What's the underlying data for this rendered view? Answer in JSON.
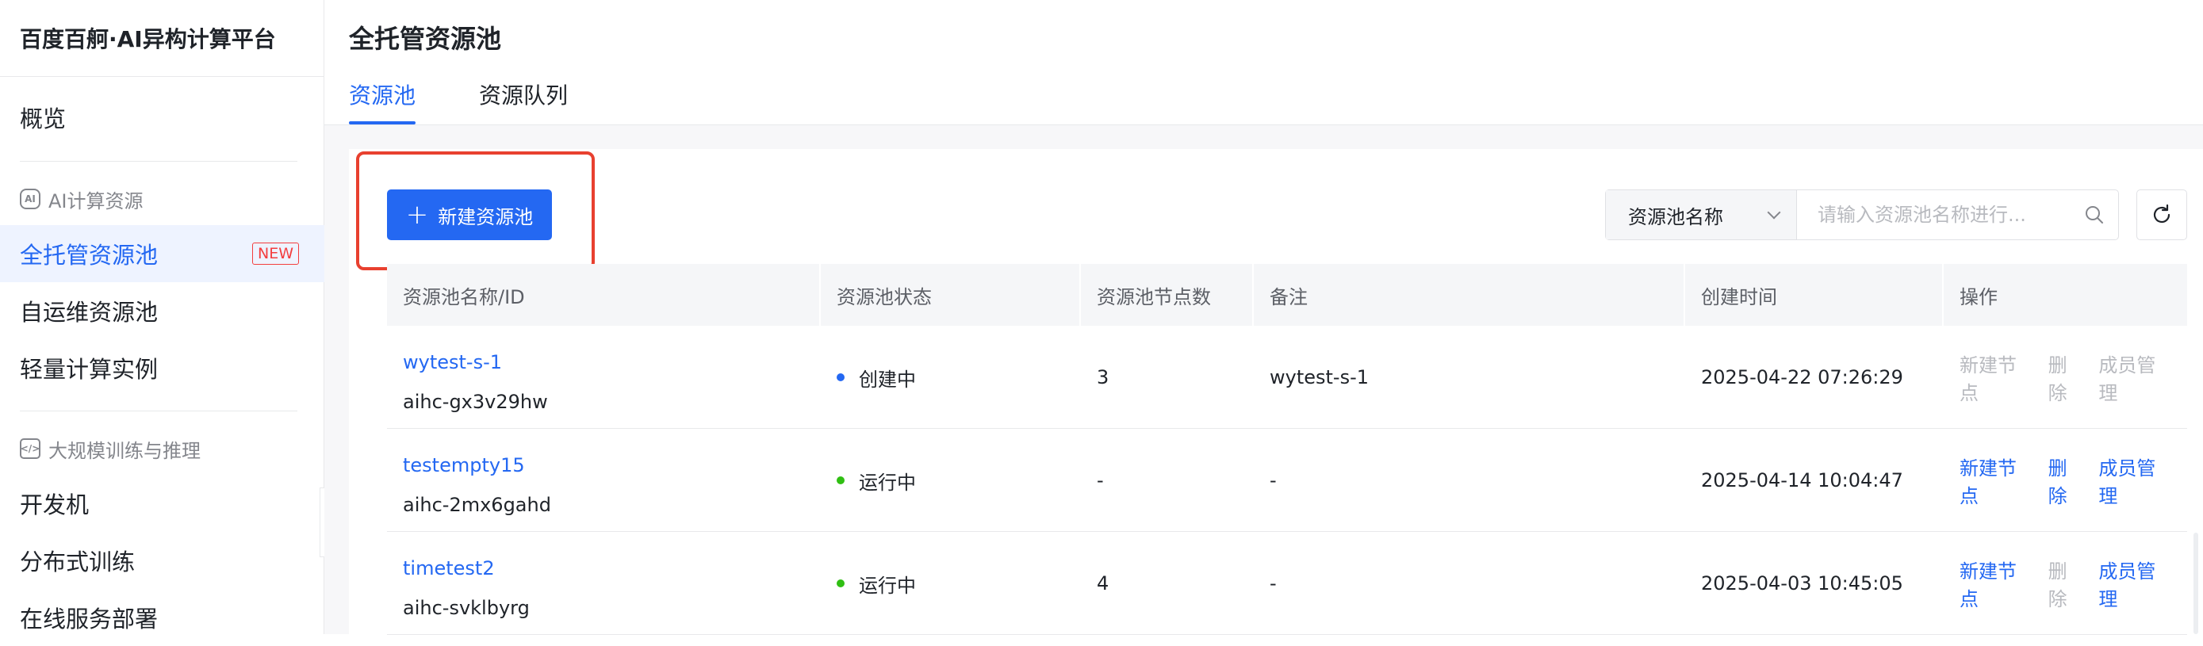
{
  "app": {
    "brand": "百度百舸·AI异构计算平台"
  },
  "sidebar": {
    "overview": "概览",
    "group_ai": {
      "label": "AI计算资源",
      "icon": "ai-chip-icon"
    },
    "items_ai": [
      {
        "label": "全托管资源池",
        "badge": "NEW",
        "active": true
      },
      {
        "label": "自运维资源池"
      },
      {
        "label": "轻量计算实例"
      }
    ],
    "group_train": {
      "label": "大规模训练与推理",
      "icon": "code-icon"
    },
    "items_train": [
      {
        "label": "开发机"
      },
      {
        "label": "分布式训练"
      },
      {
        "label": "在线服务部署"
      }
    ]
  },
  "header": {
    "title": "全托管资源池",
    "tabs": [
      {
        "label": "资源池",
        "active": true
      },
      {
        "label": "资源队列"
      }
    ]
  },
  "toolbar": {
    "create_label": "新建资源池",
    "search_select": "资源池名称",
    "search_placeholder": "请输入资源池名称进行..."
  },
  "table": {
    "columns": [
      "资源池名称/ID",
      "资源池状态",
      "资源池节点数",
      "备注",
      "创建时间",
      "操作"
    ],
    "rows": [
      {
        "name": "wytest-s-1",
        "id": "aihc-gx3v29hw",
        "status": "创建中",
        "status_color": "#2468f2",
        "nodes": "3",
        "remark": "wytest-s-1",
        "created": "2025-04-22 07:26:29",
        "actions": [
          {
            "label": "新建节点",
            "enabled": false
          },
          {
            "label": "删除",
            "enabled": false
          },
          {
            "label": "成员管理",
            "enabled": false
          }
        ]
      },
      {
        "name": "testempty15",
        "id": "aihc-2mx6gahd",
        "status": "运行中",
        "status_color": "#30bf13",
        "nodes": "-",
        "remark": "-",
        "created": "2025-04-14 10:04:47",
        "actions": [
          {
            "label": "新建节点",
            "enabled": true
          },
          {
            "label": "删除",
            "enabled": true
          },
          {
            "label": "成员管理",
            "enabled": true
          }
        ]
      },
      {
        "name": "timetest2",
        "id": "aihc-svklbyrg",
        "status": "运行中",
        "status_color": "#30bf13",
        "nodes": "4",
        "remark": "-",
        "created": "2025-04-03 10:45:05",
        "actions": [
          {
            "label": "新建节点",
            "enabled": true
          },
          {
            "label": "删除",
            "enabled": false
          },
          {
            "label": "成员管理",
            "enabled": true
          }
        ]
      }
    ]
  },
  "colors": {
    "accent": "#2468f2",
    "highlight": "#e8402f",
    "danger": "#f33e3e"
  }
}
